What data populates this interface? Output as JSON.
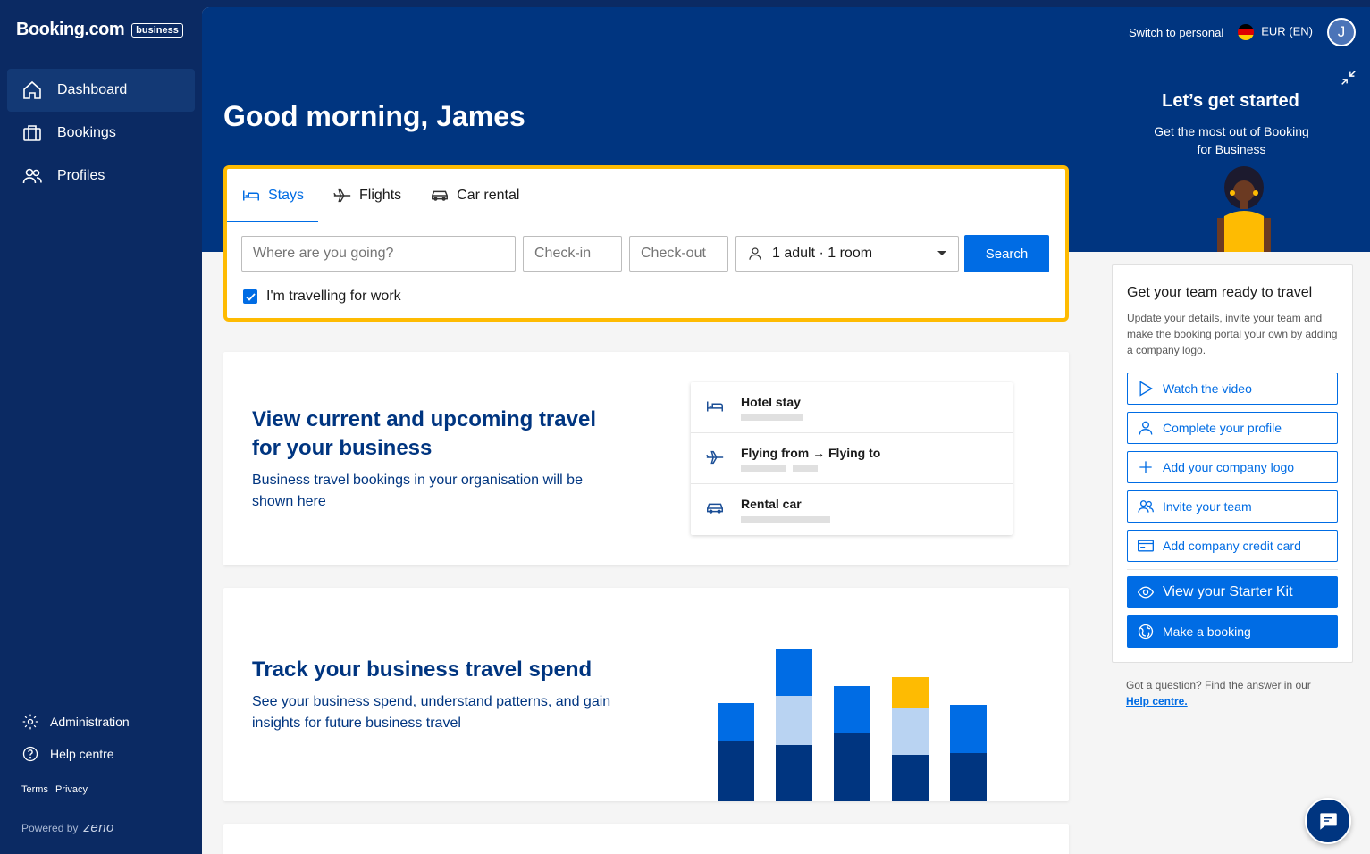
{
  "brand": {
    "name": "Booking.com",
    "badge": "business"
  },
  "sidebar": {
    "nav": [
      {
        "label": "Dashboard",
        "icon": "home-icon",
        "active": true
      },
      {
        "label": "Bookings",
        "icon": "briefcase-icon",
        "active": false
      },
      {
        "label": "Profiles",
        "icon": "people-icon",
        "active": false
      }
    ],
    "bottom": [
      {
        "label": "Administration",
        "icon": "gear-icon"
      },
      {
        "label": "Help centre",
        "icon": "question-icon"
      }
    ],
    "legal": {
      "terms": "Terms",
      "privacy": "Privacy"
    },
    "powered_by": "Powered by",
    "powered_brand": "zeno"
  },
  "topbar": {
    "switch_label": "Switch to personal",
    "currency": "EUR (EN)",
    "avatar_initial": "J"
  },
  "greeting": "Good morning, James",
  "search": {
    "tabs": [
      {
        "label": "Stays",
        "icon": "bed-icon",
        "active": true
      },
      {
        "label": "Flights",
        "icon": "plane-icon",
        "active": false
      },
      {
        "label": "Car rental",
        "icon": "car-icon",
        "active": false
      }
    ],
    "destination_placeholder": "Where are you going?",
    "checkin_placeholder": "Check-in",
    "checkout_placeholder": "Check-out",
    "guests_value": "1 adult · 1 room",
    "search_label": "Search",
    "work_label": "I'm travelling for work",
    "work_checked": true
  },
  "travel_card": {
    "title": "View current and upcoming travel for your business",
    "description": "Business travel bookings in your organisation will be shown here",
    "items": [
      {
        "label": "Hotel stay",
        "icon": "bed-icon"
      },
      {
        "label": "Flying from → Flying to",
        "icon": "plane-icon"
      },
      {
        "label": "Rental car",
        "icon": "car-icon"
      }
    ]
  },
  "spend_card": {
    "title": "Track your business travel spend",
    "description": "See your business spend, understand patterns, and gain insights for future business travel"
  },
  "spend_chart_colors": {
    "dark": "#003580",
    "mid": "#006ce4",
    "light": "#b9d3f2",
    "accent": "#febb02"
  },
  "right_panel": {
    "title": "Let’s get started",
    "subtitle": "Get the most out of Booking for Business",
    "card_title": "Get your team ready to travel",
    "card_desc": "Update your details, invite your team and make the booking portal your own by adding a company logo.",
    "actions": [
      {
        "label": "Watch the video",
        "icon": "play-icon"
      },
      {
        "label": "Complete your profile",
        "icon": "person-icon"
      },
      {
        "label": "Add your company logo",
        "icon": "plus-icon"
      },
      {
        "label": "Invite your team",
        "icon": "people-icon"
      },
      {
        "label": "Add company credit card",
        "icon": "credit-card-icon"
      }
    ],
    "primary_actions": [
      {
        "label": "View your Starter Kit",
        "icon": "eye-icon"
      },
      {
        "label": "Make a booking",
        "icon": "globe-icon"
      }
    ],
    "help_text": "Got a question? Find the answer in our",
    "help_link": "Help centre."
  },
  "colors": {
    "brand_dark": "#003580",
    "sidebar": "#0b2a63",
    "primary": "#006ce4",
    "highlight": "#febb02"
  }
}
